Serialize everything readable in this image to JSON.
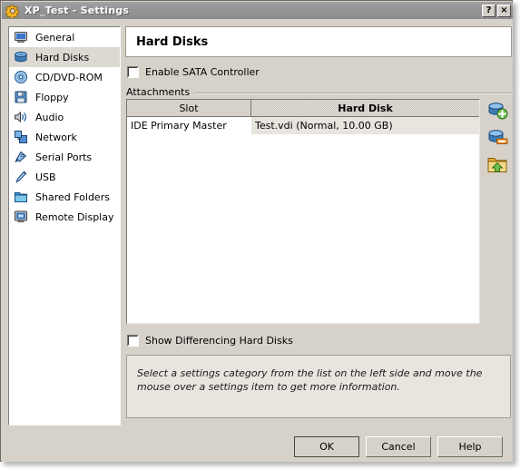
{
  "window": {
    "title": "XP_Test - Settings",
    "icon": "gear-icon",
    "help_button": "?",
    "close_button": "×"
  },
  "sidebar": {
    "items": [
      {
        "label": "General",
        "icon": "monitor-icon",
        "selected": false
      },
      {
        "label": "Hard Disks",
        "icon": "harddisk-icon",
        "selected": true
      },
      {
        "label": "CD/DVD-ROM",
        "icon": "cd-icon",
        "selected": false
      },
      {
        "label": "Floppy",
        "icon": "floppy-icon",
        "selected": false
      },
      {
        "label": "Audio",
        "icon": "speaker-icon",
        "selected": false
      },
      {
        "label": "Network",
        "icon": "network-icon",
        "selected": false
      },
      {
        "label": "Serial Ports",
        "icon": "serial-port-icon",
        "selected": false
      },
      {
        "label": "USB",
        "icon": "usb-icon",
        "selected": false
      },
      {
        "label": "Shared Folders",
        "icon": "folder-icon",
        "selected": false
      },
      {
        "label": "Remote Display",
        "icon": "remote-display-icon",
        "selected": false
      }
    ]
  },
  "main": {
    "page_title": "Hard Disks",
    "enable_sata": {
      "label": "Enable SATA Controller",
      "checked": false
    },
    "attachments_group_label": "Attachments",
    "table": {
      "columns": [
        "Slot",
        "Hard Disk"
      ],
      "rows": [
        {
          "slot": "IDE Primary Master",
          "hard_disk": "Test.vdi (Normal, 10.00 GB)"
        }
      ]
    },
    "toolbar": [
      {
        "name": "add-hard-disk-button",
        "tooltip": "Add Attachment"
      },
      {
        "name": "remove-hard-disk-button",
        "tooltip": "Remove Attachment"
      },
      {
        "name": "select-hard-disk-button",
        "tooltip": "Select Hard Disk"
      }
    ],
    "show_differencing": {
      "label": "Show Differencing Hard Disks",
      "checked": false
    },
    "info_text": "Select a settings category from the list on the left side and move the mouse over a settings item to get more information."
  },
  "buttons": {
    "ok": "OK",
    "cancel": "Cancel",
    "help": "Help"
  },
  "colors": {
    "window_bg": "#d6d2ca",
    "titlebar": "#919191",
    "selection": "#dcd9d2",
    "info_bg": "#e8e5df"
  }
}
